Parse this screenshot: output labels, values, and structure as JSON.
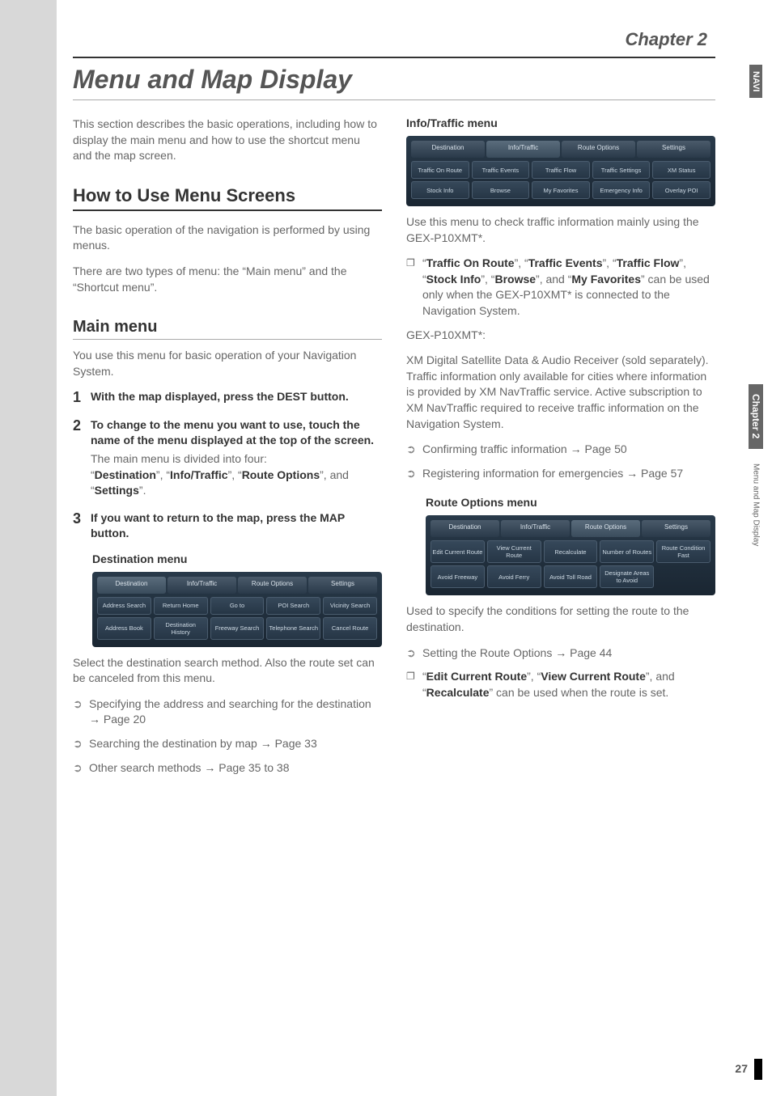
{
  "chapter_label": "Chapter 2",
  "main_title": "Menu and Map Display",
  "page_number": "27",
  "side_tabs": {
    "nav": "NAVI",
    "chapter": "Chapter 2",
    "section": "Menu and Map Display"
  },
  "intro": "This section describes the basic operations, including how to display the main menu and how to use the shortcut menu and the map screen.",
  "sec1": {
    "heading": "How to Use Menu Screens",
    "p1": "The basic operation of the navigation is performed by using menus.",
    "p2": "There are two types of menu: the “Main menu” and the “Shortcut menu”."
  },
  "sec2": {
    "heading": "Main menu",
    "intro": "You use this menu for basic operation of your Navigation System.",
    "step1": "With the map displayed, press the DEST button.",
    "step2": "To change to the menu you want to use, touch the name of the menu displayed at the top of the screen.",
    "step2_sub_a": "The main menu is divided into four:",
    "step2_sub_b": "“Destination”, “Info/Traffic”, “Route Options”, and “Settings”.",
    "step3": "If you want to return to the map, press the MAP button."
  },
  "dest_menu": {
    "heading": "Destination menu",
    "tabs": [
      "Destination",
      "Info/Traffic",
      "Route Options",
      "Settings"
    ],
    "row1": [
      "Address Search",
      "Return Home",
      "Go to",
      "POI Search",
      "Vicinity Search"
    ],
    "row2": [
      "Address Book",
      "Destination History",
      "Freeway Search",
      "Telephone Search",
      "Cancel Route"
    ],
    "body": "Select the destination search method. Also the route set can be canceled from this menu.",
    "links": {
      "l1a": "Specifying the address and searching for the destination ",
      "l1b": " Page 20",
      "l2a": "Searching the destination by map ",
      "l2b": " Page 33",
      "l3a": "Other search methods ",
      "l3b": " Page 35 to 38"
    }
  },
  "info_menu": {
    "heading": "Info/Traffic menu",
    "tabs": [
      "Destination",
      "Info/Traffic",
      "Route Options",
      "Settings"
    ],
    "row1": [
      "Traffic On Route",
      "Traffic Events",
      "Traffic Flow",
      "Traffic Settings",
      "XM Status"
    ],
    "row2": [
      "Stock Info",
      "Browse",
      "My Favorites",
      "Emergency Info",
      "Overlay POI"
    ],
    "body": "Use this menu to check traffic information mainly using the GEX-P10XMT*.",
    "note_line": "“Traffic On Route”, “Traffic Events”, “Traffic Flow”, “Stock Info”, “Browse”, and “My Favorites” can be used only when the GEX-P10XMT* is connected to the Navigation System.",
    "gex_head": "GEX-P10XMT*:",
    "gex_body": "XM Digital Satellite Data & Audio Receiver (sold separately). Traffic information only available for cities where information is provided by XM NavTraffic service. Active subscription to XM NavTraffic required to receive traffic information on the Navigation System.",
    "links": {
      "l1a": "Confirming traffic information ",
      "l1b": " Page 50",
      "l2a": "Registering information for emergencies ",
      "l2b": " Page 57"
    }
  },
  "route_menu": {
    "heading": "Route Options menu",
    "tabs": [
      "Destination",
      "Info/Traffic",
      "Route Options",
      "Settings"
    ],
    "row1": [
      "Edit Current Route",
      "View Current Route",
      "Recalculate",
      "Number of Routes",
      "Route Condition Fast"
    ],
    "row2": [
      "Avoid Freeway",
      "Avoid Ferry",
      "Avoid Toll Road",
      "Designate Areas to Avoid",
      ""
    ],
    "body": "Used to specify the conditions for setting the route to the destination.",
    "links": {
      "l1a": "Setting the Route Options ",
      "l1b": " Page 44"
    },
    "note_line": "“Edit Current Route”, “View Current Route”, and “Recalculate” can be used when the route is set."
  }
}
